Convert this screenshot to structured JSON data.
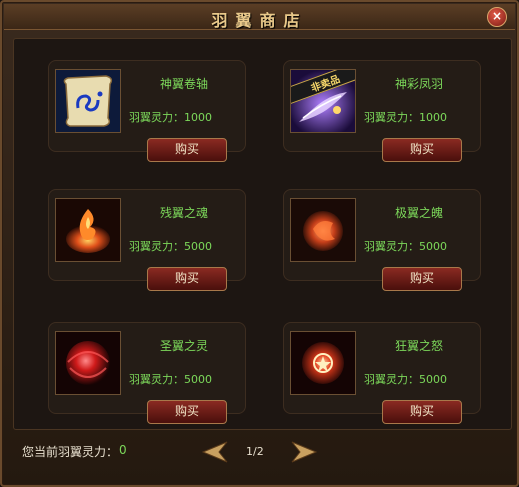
{
  "window": {
    "title": "羽翼商店",
    "close_label": "×"
  },
  "items": [
    {
      "name": "神翼卷轴",
      "power": "羽翼灵力：1000",
      "buy_label": "购买",
      "icon": "scroll-icon"
    },
    {
      "name": "神彩凤羽",
      "power": "羽翼灵力：1000",
      "buy_label": "购买",
      "icon": "phoenix-feather-icon",
      "badge": "非卖品"
    },
    {
      "name": "残翼之魂",
      "power": "羽翼灵力：5000",
      "buy_label": "购买",
      "icon": "fire-soul-icon"
    },
    {
      "name": "极翼之魄",
      "power": "羽翼灵力：5000",
      "buy_label": "购买",
      "icon": "fire-spirit-icon"
    },
    {
      "name": "圣翼之灵",
      "power": "羽翼灵力：5000",
      "buy_label": "购买",
      "icon": "red-orb-icon"
    },
    {
      "name": "狂翼之怒",
      "power": "羽翼灵力：5000",
      "buy_label": "购买",
      "icon": "rage-orb-icon"
    }
  ],
  "footer": {
    "label": "您当前羽翼灵力：",
    "value": "0",
    "page": "1/2"
  },
  "colors": {
    "accent_text": "#7cd85a",
    "title": "#e9c98a",
    "button": "#8a2a22"
  }
}
